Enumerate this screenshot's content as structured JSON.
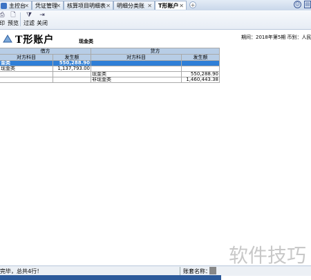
{
  "tabs": [
    {
      "label": "主控台",
      "active": false
    },
    {
      "label": "凭证管理",
      "active": false
    },
    {
      "label": "核算项目明细表",
      "active": false
    },
    {
      "label": "明细分类账",
      "active": false
    },
    {
      "label": "T形账户",
      "active": true
    }
  ],
  "toolbar": {
    "print": "印",
    "preview": "预览",
    "filter": "过滤",
    "close": "关闭"
  },
  "header": {
    "title": "T形账户",
    "account": "现金类",
    "period": "期间：2018年第5期  币别：人民"
  },
  "table": {
    "debit_title": "借方",
    "credit_title": "贷方",
    "col_contra": "对方科目",
    "col_amount": "发生额",
    "rows": [
      {
        "d_subject": "金类",
        "d_amount": "550,288.90",
        "c_subject": "",
        "c_amount": "",
        "selected": true
      },
      {
        "d_subject": "现金类",
        "d_amount": "1,137,793.00",
        "c_subject": "",
        "c_amount": "",
        "selected": false
      },
      {
        "d_subject": "",
        "d_amount": "",
        "c_subject": "现金类",
        "c_amount": "550,288.90",
        "selected": false
      },
      {
        "d_subject": "",
        "d_amount": "",
        "c_subject": "非现金类",
        "c_amount": "1,460,443.38",
        "selected": false
      }
    ]
  },
  "status": {
    "message": "完毕，总共4行！",
    "account_label": "账套名称："
  },
  "watermark": "软件技巧",
  "colors": {
    "header_blue": "#b7cde6",
    "selection": "#2f7fd7",
    "statusbar_blue": "#2d5b9b"
  }
}
